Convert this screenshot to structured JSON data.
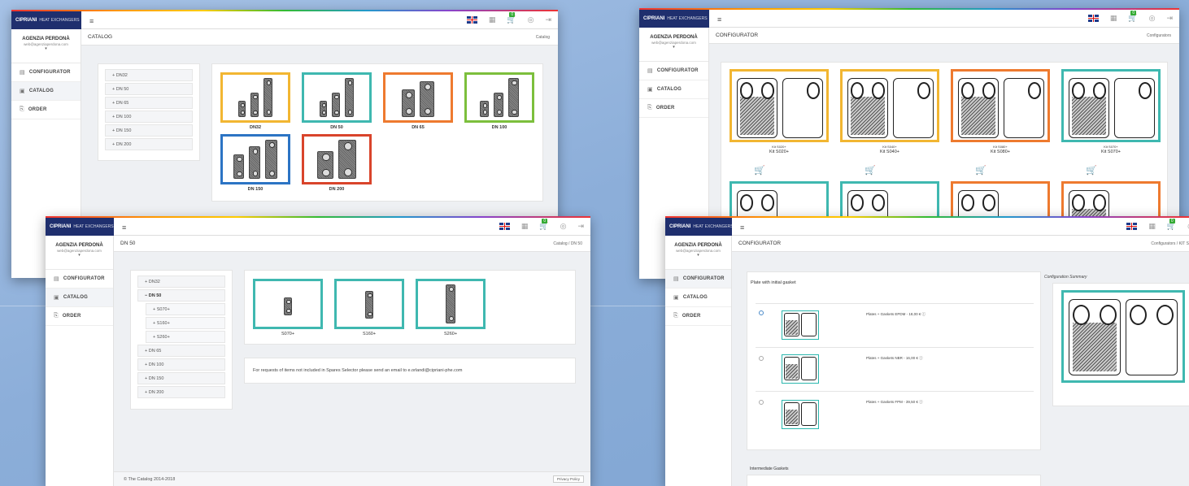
{
  "brand": {
    "name": "CIPRIANI",
    "subtitle": "HEAT EXCHANGERS"
  },
  "user": {
    "name": "AGENZIA PERDONÀ",
    "email": "web@agenziaperdona.com"
  },
  "menu": {
    "configurator": "CONFIGURATOR",
    "catalog": "CATALOG",
    "order": "ORDER"
  },
  "topbar": {
    "cart_count": "0",
    "language": "en-gb-flag"
  },
  "colors": {
    "yellow": "#f2b632",
    "teal": "#3fb8b0",
    "orange": "#ee7a2f",
    "green": "#7cbf3c",
    "blue": "#2c74c4",
    "red": "#d9442b",
    "navy": "#1f2f6e"
  },
  "win1": {
    "page_title": "CATALOG",
    "breadcrumb": "Catalog",
    "tree": [
      "DN32",
      "DN 50",
      "DN 65",
      "DN 100",
      "DN 150",
      "DN 200"
    ],
    "cards": [
      {
        "label": "DN32"
      },
      {
        "label": "DN 50"
      },
      {
        "label": "DN 65"
      },
      {
        "label": "DN 100"
      },
      {
        "label": "DN 150"
      },
      {
        "label": "DN 200"
      }
    ]
  },
  "win2": {
    "page_title": "CONFIGURATOR",
    "breadcrumb": "Configurators",
    "kits": [
      {
        "small": "Kit S020+",
        "label": "Kit S020+"
      },
      {
        "small": "Kit S040+",
        "label": "Kit S040+"
      },
      {
        "small": "Kit S080+",
        "label": "Kit S080+"
      },
      {
        "small": "Kit S070+",
        "label": "Kit S070+"
      }
    ]
  },
  "win3": {
    "page_title": "DN 50",
    "breadcrumb": "Catalog  /  DN 50",
    "tree": [
      {
        "label": "DN32",
        "sub": false
      },
      {
        "label": "DN 50",
        "sub": false,
        "open": true
      },
      {
        "label": "S070+",
        "sub": true
      },
      {
        "label": "S160+",
        "sub": true
      },
      {
        "label": "S260+",
        "sub": true
      },
      {
        "label": "DN 65",
        "sub": false
      },
      {
        "label": "DN 100",
        "sub": false
      },
      {
        "label": "DN 150",
        "sub": false
      },
      {
        "label": "DN 200",
        "sub": false
      }
    ],
    "products": [
      {
        "label": "S070+"
      },
      {
        "label": "S160+"
      },
      {
        "label": "S260+"
      }
    ],
    "notice": "For requests of items not included in Spares Selector please send an email to e.orlandi@cipriani-phe.com",
    "footer": "© The Catalog 2014-2018",
    "privacy": "Privacy Policy"
  },
  "win4": {
    "page_title": "CONFIGURATOR",
    "breadcrumb": "Configurators  /  KIT S",
    "section": "Plate with initial gasket",
    "options": [
      {
        "label": "Plates + Gaskets EPDM - 18,00 € ⓘ",
        "selected": true
      },
      {
        "label": "Plates + Gaskets NBR - 16,00 € ⓘ",
        "selected": false
      },
      {
        "label": "Plates + Gaskets FPM - 39,50 € ⓘ",
        "selected": false
      }
    ],
    "summary_title": "Configuration Summary",
    "section2": "Intermediate Gaskets"
  }
}
